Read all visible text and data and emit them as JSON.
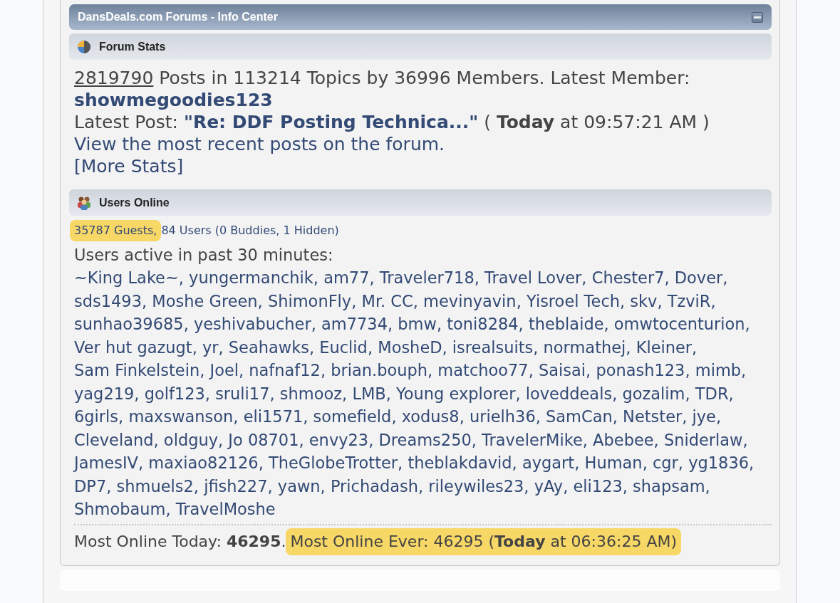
{
  "info_center": {
    "title": "DansDeals.com Forums - Info Center",
    "collapsed": false
  },
  "forum_stats": {
    "heading": "Forum Stats",
    "total_posts": "2819790",
    "summary": "Posts in 113214 Topics by 36996 Members. Latest Member:",
    "latest_member": "showmegoodies123",
    "latest_post_label": "Latest Post:",
    "latest_post_title": "\"Re: DDF Posting Technica...\"",
    "latest_post_time": "( **Today** at 09:57:21 AM )",
    "recent_link": "View the most recent posts on the forum.",
    "more_stats": "[More Stats]"
  },
  "users_online": {
    "heading": "Users Online",
    "counts": [
      {
        "text": "35787 Guests,",
        "highlighted": true
      },
      {
        "text": "84 Users (0 Buddies, 1 Hidden)",
        "highlighted": false
      }
    ],
    "active_label": "Users active in past 30 minutes:",
    "users": [
      "~King Lake~,",
      "yungermanchik,",
      "am77,",
      "Traveler718,",
      "Travel Lover,",
      "Chester7,",
      "Dover,",
      "sds1493,",
      "Moshe Green,",
      "ShimonFly,",
      "Mr. CC,",
      "mevinyavin,",
      "Yisroel Tech,",
      "skv,",
      "TzviR,",
      "sunhao39685,",
      "yeshivabucher,",
      "am7734,",
      "bmw,",
      "toni8284,",
      "theblaide,",
      "omwtocenturion,",
      "Ver hut gazugt,",
      "yr,",
      "Seahawks,",
      "Euclid,",
      "MosheD,",
      "isrealsuits,",
      "normathej,",
      "Kleiner,",
      "Sam Finkelstein,",
      "Joel,",
      "nafnaf12,",
      "brian.bouph,",
      "matchoo77,",
      "Saisai,",
      "ponash123,",
      "mimb,",
      "yag219,",
      "golf123,",
      "sruli17,",
      "shmooz,",
      "LMB,",
      "Young explorer,",
      "loveddeals,",
      "gozalim,",
      "TDR,",
      "6girls,",
      "maxswanson,",
      "eli1571,",
      "somefield,",
      "xodus8,",
      "urielh36,",
      "SamCan,",
      "Netster,",
      "jye,",
      "Cleveland,",
      "oldguy,",
      "Jo 08701,",
      "envy23,",
      "Dreams250,",
      "TravelerMike,",
      "Abebee,",
      "Sniderlaw,",
      "JamesIV,",
      "maxiao82126,",
      "TheGlobeTrotter,",
      "theblakdavid,",
      "aygart,",
      "Human,",
      "cgr,",
      "yg1836,",
      "DP7,",
      "shmuels2,",
      "jfish227,",
      "yawn,",
      "Prichadash,",
      "rileywiles23,",
      "yAy,",
      "eli123,",
      "shapsam,",
      "Shmobaum,",
      "TravelMoshe"
    ],
    "most_online": [
      {
        "text": "Most Online Today: **46295**.",
        "highlighted": false
      },
      {
        "text": "Most Online Ever: 46295 (**Today** at 06:36:25 AM)",
        "highlighted": true
      }
    ]
  }
}
